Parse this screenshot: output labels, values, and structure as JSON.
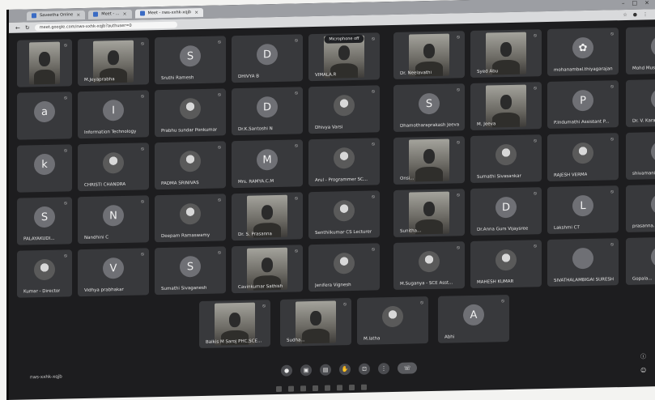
{
  "browser": {
    "tabs": [
      {
        "title": "Saveetha Online"
      },
      {
        "title": "Meet - ..."
      },
      {
        "title": "Meet - nws-xxhk-xqjb"
      }
    ],
    "url": "meet.google.com/nws-xxhk-xqjb?authuser=0"
  },
  "meeting": {
    "code": "nws-xxhk-xqjb",
    "presenting_banner": "Microphone off"
  },
  "participants": [
    {
      "name": "",
      "kind": "video"
    },
    {
      "name": "M.Jeyaprabha",
      "kind": "video"
    },
    {
      "name": "Sruthi Ramesh",
      "kind": "avatar",
      "initial": "S"
    },
    {
      "name": "DHIVYA B",
      "kind": "avatar",
      "initial": "D"
    },
    {
      "name": "VIMALA.R",
      "kind": "video"
    },
    {
      "name": "Dr. Neelavathi",
      "kind": "video"
    },
    {
      "name": "Syed Abu",
      "kind": "video"
    },
    {
      "name": "mohanambal.thiyagarajan",
      "kind": "avatar",
      "initial": "✿"
    },
    {
      "name": "Mohd Mus...",
      "kind": "avatar",
      "initial": ""
    },
    {
      "name": "",
      "kind": "avatar",
      "initial": "a"
    },
    {
      "name": "Information Technology",
      "kind": "avatar",
      "initial": "I"
    },
    {
      "name": "Prabhu sundar Ponkumar",
      "kind": "photo",
      "initial": ""
    },
    {
      "name": "Dr.K.Santoshi N",
      "kind": "avatar",
      "initial": "D"
    },
    {
      "name": "Dhivya Varsi",
      "kind": "photo",
      "initial": ""
    },
    {
      "name": "Dhamotharaprakash Jeeva",
      "kind": "avatar",
      "initial": "S"
    },
    {
      "name": "M. Jeeva",
      "kind": "video"
    },
    {
      "name": "P.Indumathi Assistant P...",
      "kind": "avatar",
      "initial": "P"
    },
    {
      "name": "Dr. V. Kara...",
      "kind": "avatar",
      "initial": ""
    },
    {
      "name": "",
      "kind": "avatar",
      "initial": "k"
    },
    {
      "name": "CHRISTI CHANDRA",
      "kind": "photo",
      "initial": ""
    },
    {
      "name": "PADMA SRINIVAS",
      "kind": "photo",
      "initial": ""
    },
    {
      "name": "Mrs. RAMYA.C.M",
      "kind": "avatar",
      "initial": "M"
    },
    {
      "name": "Arul - Programmer SC...",
      "kind": "photo",
      "initial": ""
    },
    {
      "name": "Onsi...",
      "kind": "video"
    },
    {
      "name": "Sumathi Sivasankar",
      "kind": "photo",
      "initial": ""
    },
    {
      "name": "RAJESH VERMA",
      "kind": "photo",
      "initial": ""
    },
    {
      "name": "shivamani...",
      "kind": "avatar",
      "initial": ""
    },
    {
      "name": "PALAYAKUDI...",
      "kind": "avatar",
      "initial": "S"
    },
    {
      "name": "Nandhini C",
      "kind": "avatar",
      "initial": "N"
    },
    {
      "name": "Deepam Ramaswamy",
      "kind": "photo",
      "initial": ""
    },
    {
      "name": "Dr. S. Prasanna",
      "kind": "video"
    },
    {
      "name": "Senthilkumar CS Lecturer",
      "kind": "photo",
      "initial": ""
    },
    {
      "name": "Sunitha...",
      "kind": "video"
    },
    {
      "name": "Dr.Anna Gurs Vijaysree",
      "kind": "avatar",
      "initial": "D"
    },
    {
      "name": "Lakshmi CT",
      "kind": "avatar",
      "initial": "L"
    },
    {
      "name": "prasanna...",
      "kind": "avatar",
      "initial": ""
    },
    {
      "name": "Kumar - Director",
      "kind": "photo",
      "initial": ""
    },
    {
      "name": "Vidhya prabhakar",
      "kind": "avatar",
      "initial": "V"
    },
    {
      "name": "Sumathi Sivaganesh",
      "kind": "avatar",
      "initial": "S"
    },
    {
      "name": "Cavinkumar Sathish",
      "kind": "video"
    },
    {
      "name": "Jenifera Vignesh",
      "kind": "photo",
      "initial": ""
    },
    {
      "name": "M.Suganya - SCE Asst...",
      "kind": "photo",
      "initial": ""
    },
    {
      "name": "MAHESH KUMAR",
      "kind": "photo",
      "initial": ""
    },
    {
      "name": "SIVATHALAMBIGAI SURESH",
      "kind": "avatar",
      "initial": ""
    },
    {
      "name": "Gopala...",
      "kind": "avatar",
      "initial": ""
    },
    {
      "name": "Balkis M Saroj PHC.SCE...",
      "kind": "video"
    },
    {
      "name": "Sudha...",
      "kind": "video"
    },
    {
      "name": "M.latha",
      "kind": "photo",
      "initial": ""
    },
    {
      "name": "Abhi",
      "kind": "avatar",
      "initial": "A"
    }
  ],
  "controls": [
    {
      "icon": "mic-icon",
      "glyph": "●"
    },
    {
      "icon": "camera-icon",
      "glyph": "▣"
    },
    {
      "icon": "captions-icon",
      "glyph": "▤"
    },
    {
      "icon": "raise-hand-icon",
      "glyph": "✋"
    },
    {
      "icon": "present-icon",
      "glyph": "⊡"
    },
    {
      "icon": "more-icon",
      "glyph": "⋮"
    },
    {
      "icon": "leave-call-icon",
      "glyph": "☏"
    }
  ]
}
